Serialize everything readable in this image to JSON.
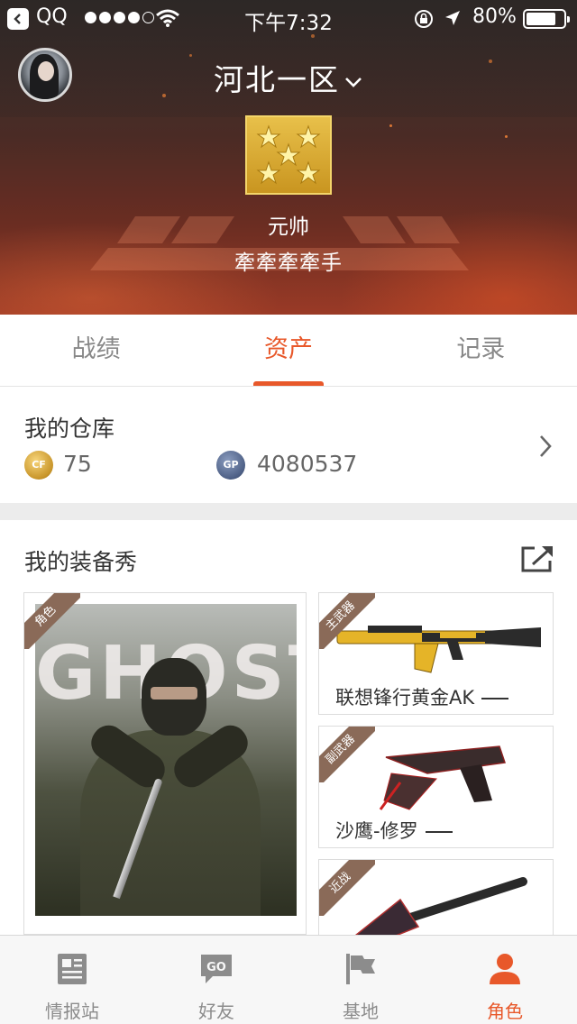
{
  "status_bar": {
    "carrier": "QQ",
    "time": "下午7:32",
    "battery": "80%"
  },
  "header": {
    "server": "河北一区",
    "rank_title": "元帅",
    "nickname": "牽牽牽牽手"
  },
  "tabs": [
    {
      "label": "战绩",
      "active": false
    },
    {
      "label": "资产",
      "active": true
    },
    {
      "label": "记录",
      "active": false
    }
  ],
  "warehouse": {
    "title": "我的仓库",
    "cf_coin_label": "CF",
    "cf_coins": "75",
    "gp_label": "GP",
    "gp": "4080537"
  },
  "equipment": {
    "title": "我的装备秀",
    "character": {
      "tag": "角色",
      "art_text": "GHOST"
    },
    "primary": {
      "tag": "主武器",
      "name": "联想锋行黄金AK"
    },
    "secondary": {
      "tag": "副武器",
      "name": "沙鹰-修罗"
    },
    "melee": {
      "tag": "近战"
    }
  },
  "bottom_nav": [
    {
      "label": "情报站",
      "icon": "news-icon"
    },
    {
      "label": "好友",
      "icon": "go-chat-icon"
    },
    {
      "label": "基地",
      "icon": "flag-icon"
    },
    {
      "label": "角色",
      "icon": "person-icon"
    }
  ],
  "colors": {
    "accent": "#e8582a",
    "tag": "#8a6a58"
  }
}
